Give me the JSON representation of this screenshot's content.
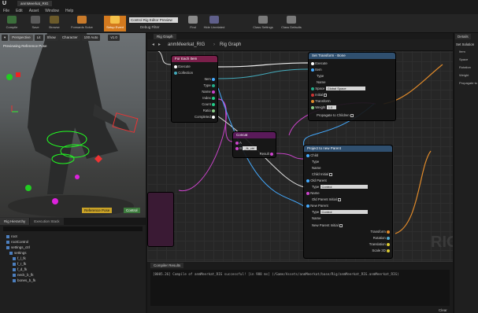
{
  "window": {
    "title": "anmMeerkat_RIG"
  },
  "menu": [
    "File",
    "Edit",
    "Asset",
    "Window",
    "Help"
  ],
  "toolbar": {
    "buttons": [
      "Compile",
      "Save",
      "Browse",
      "Forwards Solve",
      "Setup Event",
      "Find",
      "Hide Unrelated",
      "Class Settings",
      "Class Defaults"
    ],
    "preview_dropdown": "Control Rig Editor Preview",
    "debug_label": "Debug Filter"
  },
  "viewport": {
    "buttons": [
      "Perspective",
      "Lit",
      "Show",
      "Character",
      "100 Auto",
      "v1.0"
    ],
    "title": "Previewing Reference Pose",
    "reference_pose_button": "Reference Pose",
    "control_button": "Control"
  },
  "hierarchy": {
    "tabs": [
      "Rig Hierarchy",
      "Execution Stack"
    ],
    "items": [
      "root",
      "rootControl",
      "settings_ctrl",
      "settings",
      "f_l_fk",
      "f_r_fk",
      "f_d_fk",
      "neck_b_fk",
      "bones_b_fk"
    ]
  },
  "graph": {
    "tab": "Rig Graph",
    "breadcrumb": [
      "anmMeerkat_RIG",
      "Rig Graph"
    ],
    "watermark": "RIG"
  },
  "nodes": {
    "foreach": {
      "title": "For Each Item",
      "pins": [
        "Execute",
        "Collection",
        "Item",
        "Type",
        "Name",
        "Index",
        "Count",
        "Ratio",
        "Completed"
      ]
    },
    "settransform": {
      "title": "Set Transform - Bone",
      "pins": [
        "Execute",
        "Item",
        "Type",
        "Name",
        "Space",
        "Initial",
        "Transform",
        "Weight",
        "Propagate to Children"
      ],
      "space_value": "Global Space",
      "weight_value": "1.0"
    },
    "concat": {
      "title": "Concat",
      "pins": [
        "A",
        "B",
        "Result"
      ],
      "b_value": "_fk_ctrl"
    },
    "project": {
      "title": "Project to new Parent",
      "pins": [
        "Child",
        "Type",
        "Name",
        "Child Initial",
        "Old Parent",
        "Type",
        "Name",
        "Old Parent Initial",
        "New Parent",
        "Type",
        "Name",
        "New Parent Initial",
        "Transform",
        "Rotation",
        "Translation",
        "Scale 3D"
      ],
      "type_value": "Control"
    }
  },
  "compiler": {
    "tab": "Compiler Results",
    "message": "[0005.26] Compile of anmMeerkat_RIG successful! [in 988 ms] (/Game/Assets/anmMeerkat/base/Rig/anmMeerkat_RIG.anmMeerkat_RIG)",
    "clear_label": "Clear"
  },
  "details": {
    "tab": "Details",
    "header": "Set Solution",
    "props": [
      "Item",
      "Space",
      "Rotation",
      "Weight",
      "Propagate to"
    ]
  }
}
